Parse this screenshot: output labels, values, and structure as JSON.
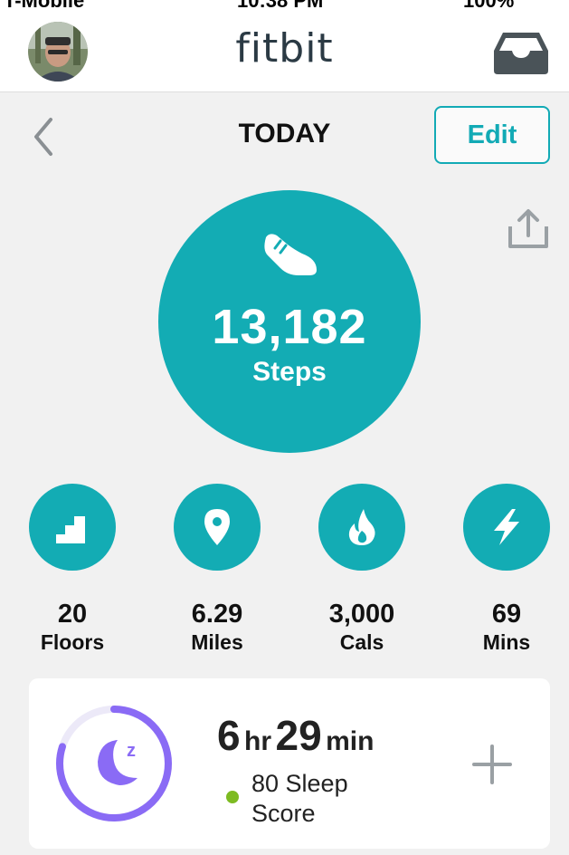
{
  "status_bar": {
    "carrier": "T-Mobile",
    "time": "10:38 PM",
    "battery": "100%"
  },
  "header": {
    "logo": "fitbit",
    "avatar_icon": "user-avatar",
    "inbox_icon": "inbox-icon"
  },
  "nav": {
    "title": "TODAY",
    "edit_label": "Edit",
    "back_icon": "chevron-left-icon",
    "share_icon": "share-icon"
  },
  "steps": {
    "value": "13,182",
    "label": "Steps",
    "icon": "shoe-icon"
  },
  "stats": [
    {
      "value": "20",
      "label": "Floors",
      "icon": "stairs-icon"
    },
    {
      "value": "6.29",
      "label": "Miles",
      "icon": "location-pin-icon"
    },
    {
      "value": "3,000",
      "label": "Cals",
      "icon": "flame-icon"
    },
    {
      "value": "69",
      "label": "Mins",
      "icon": "lightning-icon"
    }
  ],
  "sleep": {
    "hours": "6",
    "hours_unit": "hr",
    "minutes": "29",
    "minutes_unit": "min",
    "score_text": "80 Sleep Score",
    "score": 80,
    "icon": "moon-sleep-icon",
    "add_icon": "plus-icon"
  },
  "colors": {
    "teal": "#13acb4",
    "sleep_purple": "#8a6bf5",
    "score_green": "#7dbb22",
    "background": "#f1f1f1"
  }
}
